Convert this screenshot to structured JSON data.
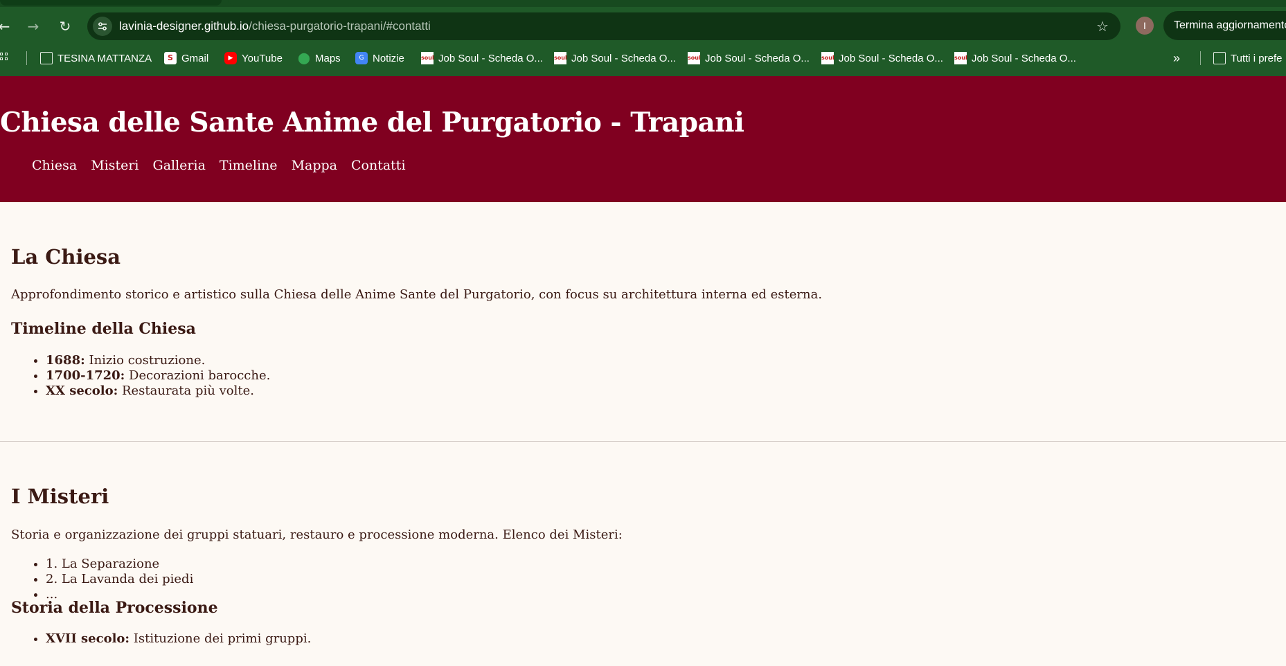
{
  "browser": {
    "url_host": "lavinia-designer.github.io",
    "url_path": "/chiesa-purgatorio-trapani/#contatti",
    "profile_initial": "I",
    "update_button": "Termina aggiornamento",
    "bookmarks": [
      {
        "label": "TESINA MATTANZA",
        "icon": "folder-icon"
      },
      {
        "label": "Gmail",
        "icon": "gmail-icon"
      },
      {
        "label": "YouTube",
        "icon": "youtube-icon"
      },
      {
        "label": "Maps",
        "icon": "maps-icon"
      },
      {
        "label": "Notizie",
        "icon": "news-icon"
      },
      {
        "label": "Job Soul - Scheda O...",
        "icon": "soul-icon"
      },
      {
        "label": "Job Soul - Scheda O...",
        "icon": "soul-icon"
      },
      {
        "label": "Job Soul - Scheda O...",
        "icon": "soul-icon"
      },
      {
        "label": "Job Soul - Scheda O...",
        "icon": "soul-icon"
      },
      {
        "label": "Job Soul - Scheda O...",
        "icon": "soul-icon"
      }
    ],
    "overflow": "»",
    "all_bookmarks": "Tutti i prefe"
  },
  "site": {
    "title": "Chiesa delle Sante Anime del Purgatorio - Trapani",
    "nav": [
      "Chiesa",
      "Misteri",
      "Galleria",
      "Timeline",
      "Mappa",
      "Contatti"
    ],
    "colors": {
      "header": "#800020",
      "background": "#fdf9f4",
      "text": "#3b1a14"
    }
  },
  "chiesa": {
    "heading": "La Chiesa",
    "intro": "Approfondimento storico e artistico sulla Chiesa delle Anime Sante del Purgatorio, con focus su architettura interna ed esterna.",
    "timeline_heading": "Timeline della Chiesa",
    "timeline": [
      {
        "term": "1688:",
        "text": " Inizio costruzione."
      },
      {
        "term": "1700-1720:",
        "text": " Decorazioni barocche."
      },
      {
        "term": "XX secolo:",
        "text": " Restaurata più volte."
      }
    ]
  },
  "misteri": {
    "heading": "I Misteri",
    "intro": "Storia e organizzazione dei gruppi statuari, restauro e processione moderna. Elenco dei Misteri:",
    "items": [
      "1. La Separazione",
      "2. La Lavanda dei piedi",
      "..."
    ],
    "processione_heading": "Storia della Processione",
    "processione": [
      {
        "term": "XVII secolo:",
        "text": " Istituzione dei primi gruppi."
      }
    ]
  }
}
